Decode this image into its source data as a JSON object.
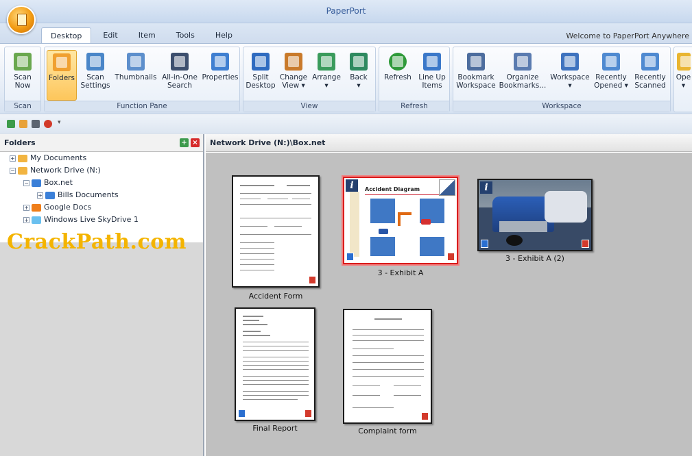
{
  "app": {
    "title": "PaperPort",
    "welcome": "Welcome to PaperPort Anywhere"
  },
  "tabs": [
    "Desktop",
    "Edit",
    "Item",
    "Tools",
    "Help"
  ],
  "ribbon": {
    "groups": [
      {
        "name": "Scan",
        "buttons": [
          {
            "label1": "Scan",
            "label2": "Now",
            "icon": "scan-icon"
          }
        ]
      },
      {
        "name": "Function Pane",
        "buttons": [
          {
            "label1": "Folders",
            "label2": "",
            "icon": "folders-icon",
            "active": true
          },
          {
            "label1": "Scan",
            "label2": "Settings",
            "icon": "scan-settings-icon"
          },
          {
            "label1": "Thumbnails",
            "label2": "",
            "icon": "thumbnails-icon"
          },
          {
            "label1": "All-in-One",
            "label2": "Search",
            "icon": "binoculars-icon"
          },
          {
            "label1": "Properties",
            "label2": "",
            "icon": "properties-icon"
          }
        ]
      },
      {
        "name": "View",
        "buttons": [
          {
            "label1": "Split",
            "label2": "Desktop",
            "icon": "split-desktop-icon"
          },
          {
            "label1": "Change",
            "label2": "View ▾",
            "icon": "change-view-icon"
          },
          {
            "label1": "Arrange",
            "label2": "▾",
            "icon": "arrange-icon"
          },
          {
            "label1": "Back",
            "label2": "▾",
            "icon": "back-icon"
          }
        ]
      },
      {
        "name": "Refresh",
        "buttons": [
          {
            "label1": "Refresh",
            "label2": "",
            "icon": "refresh-icon"
          },
          {
            "label1": "Line Up",
            "label2": "Items",
            "icon": "line-up-icon"
          }
        ]
      },
      {
        "name": "Workspace",
        "buttons": [
          {
            "label1": "Bookmark",
            "label2": "Workspace",
            "icon": "bookmark-workspace-icon"
          },
          {
            "label1": "Organize",
            "label2": "Bookmarks...",
            "icon": "organize-bookmarks-icon"
          },
          {
            "label1": "Workspace",
            "label2": "▾",
            "icon": "workspace-icon"
          },
          {
            "label1": "Recently",
            "label2": "Opened ▾",
            "icon": "recently-opened-icon"
          },
          {
            "label1": "Recently",
            "label2": "Scanned",
            "icon": "recently-scanned-icon"
          }
        ]
      },
      {
        "name": "",
        "buttons": [
          {
            "label1": "Ope",
            "label2": "▾",
            "icon": "open-icon"
          }
        ]
      }
    ]
  },
  "folders_pane": {
    "title": "Folders",
    "tree": [
      {
        "label": "My Documents",
        "expander": "+"
      },
      {
        "label": "Network Drive (N:)",
        "expander": "−"
      },
      {
        "label": "Box.net",
        "expander": "−"
      },
      {
        "label": "Bills Documents",
        "expander": "+"
      },
      {
        "label": "Google Docs",
        "expander": "+"
      },
      {
        "label": "Windows Live SkyDrive 1",
        "expander": "+"
      }
    ],
    "watermark": "CrackPath.com"
  },
  "main": {
    "path": "Network Drive (N:)\\Box.net",
    "items": [
      {
        "caption": "Accident Form"
      },
      {
        "caption": "3 - Exhibit A",
        "heading": "Accident Diagram",
        "selected": true
      },
      {
        "caption": "3 - Exhibit A (2)"
      },
      {
        "caption": "Final Report"
      },
      {
        "caption": "Complaint form"
      }
    ]
  },
  "colors": {
    "accent": "#fdc65b",
    "selection": "#d91c1c",
    "desktop_bg": "#c0c0c0"
  }
}
